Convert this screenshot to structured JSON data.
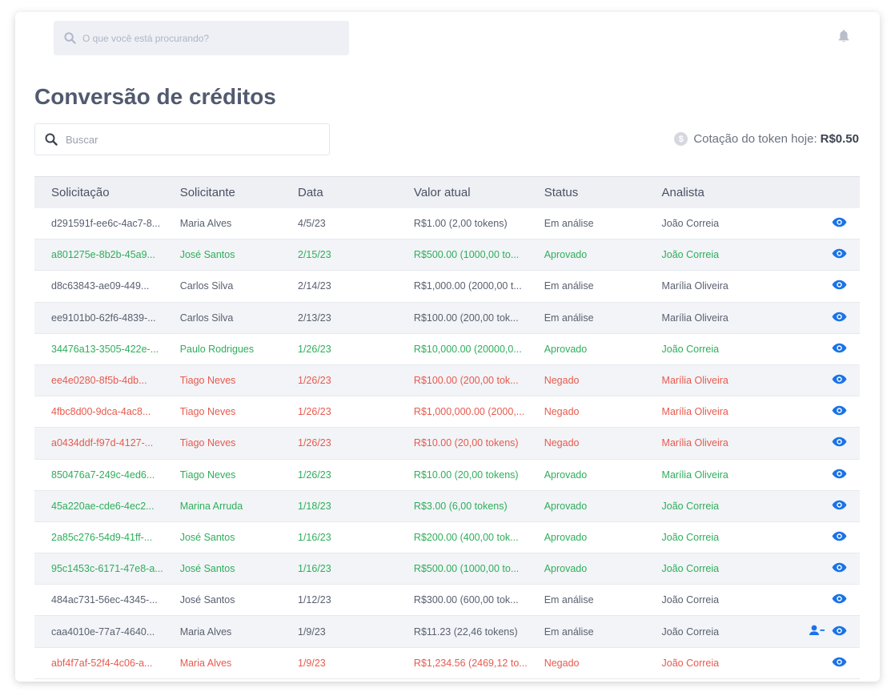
{
  "topbar": {
    "search_placeholder": "O que você está procurando?",
    "icons": {
      "search": "search-icon",
      "notifications": "bell-icon"
    }
  },
  "page": {
    "title": "Conversão de créditos",
    "search_placeholder": "Buscar",
    "quote_label": "Cotação do token hoje:",
    "quote_value": "R$0.50",
    "coin_glyph": "$"
  },
  "colors": {
    "approved": "#2fae5b",
    "denied": "#e75a4e",
    "neutral": "#5a6070",
    "action": "#1a73e8"
  },
  "table": {
    "headers": [
      "Solicitação",
      "Solicitante",
      "Data",
      "Valor atual",
      "Status",
      "Analista"
    ],
    "rows": [
      {
        "id": "d291591f-ee6c-4ac7-8...",
        "requester": "Maria Alves",
        "date": "4/5/23",
        "value": "R$1.00 (2,00 tokens)",
        "status": "Em análise",
        "analyst": "João Correia",
        "tone": "neutral",
        "assign": false
      },
      {
        "id": "a801275e-8b2b-45a9...",
        "requester": "José Santos",
        "date": "2/15/23",
        "value": "R$500.00 (1000,00 to...",
        "status": "Aprovado",
        "analyst": "João Correia",
        "tone": "ok",
        "assign": false
      },
      {
        "id": "d8c63843-ae09-449...",
        "requester": "Carlos Silva",
        "date": "2/14/23",
        "value": "R$1,000.00 (2000,00 t...",
        "status": "Em análise",
        "analyst": "Marília Oliveira",
        "tone": "neutral",
        "assign": false
      },
      {
        "id": "ee9101b0-62f6-4839-...",
        "requester": "Carlos Silva",
        "date": "2/13/23",
        "value": "R$100.00 (200,00 tok...",
        "status": "Em análise",
        "analyst": "Marília Oliveira",
        "tone": "neutral",
        "assign": false
      },
      {
        "id": "34476a13-3505-422e-...",
        "requester": "Paulo Rodrigues",
        "date": "1/26/23",
        "value": "R$10,000.00 (20000,0...",
        "status": "Aprovado",
        "analyst": "João Correia",
        "tone": "ok",
        "assign": false
      },
      {
        "id": "ee4e0280-8f5b-4db...",
        "requester": "Tiago Neves",
        "date": "1/26/23",
        "value": "R$100.00 (200,00 tok...",
        "status": "Negado",
        "analyst": "Marília Oliveira",
        "tone": "bad",
        "assign": false
      },
      {
        "id": "4fbc8d00-9dca-4ac8...",
        "requester": "Tiago Neves",
        "date": "1/26/23",
        "value": "R$1,000,000.00 (2000,...",
        "status": "Negado",
        "analyst": "Marília Oliveira",
        "tone": "bad",
        "assign": false
      },
      {
        "id": "a0434ddf-f97d-4127-...",
        "requester": "Tiago Neves",
        "date": "1/26/23",
        "value": "R$10.00 (20,00 tokens)",
        "status": "Negado",
        "analyst": "Marília Oliveira",
        "tone": "bad",
        "assign": false
      },
      {
        "id": "850476a7-249c-4ed6...",
        "requester": "Tiago Neves",
        "date": "1/26/23",
        "value": "R$10.00 (20,00 tokens)",
        "status": "Aprovado",
        "analyst": "Marília Oliveira",
        "tone": "ok",
        "assign": false
      },
      {
        "id": "45a220ae-cde6-4ec2...",
        "requester": "Marina Arruda",
        "date": "1/18/23",
        "value": "R$3.00 (6,00 tokens)",
        "status": "Aprovado",
        "analyst": "João Correia",
        "tone": "ok",
        "assign": false
      },
      {
        "id": "2a85c276-54d9-41ff-...",
        "requester": "José Santos",
        "date": "1/16/23",
        "value": "R$200.00 (400,00 tok...",
        "status": "Aprovado",
        "analyst": "João Correia",
        "tone": "ok",
        "assign": false
      },
      {
        "id": "95c1453c-6171-47e8-a...",
        "requester": "José Santos",
        "date": "1/16/23",
        "value": "R$500.00 (1000,00 to...",
        "status": "Aprovado",
        "analyst": "João Correia",
        "tone": "ok",
        "assign": false
      },
      {
        "id": "484ac731-56ec-4345-...",
        "requester": "José Santos",
        "date": "1/12/23",
        "value": "R$300.00 (600,00 tok...",
        "status": "Em análise",
        "analyst": "João Correia",
        "tone": "neutral",
        "assign": false
      },
      {
        "id": "caa4010e-77a7-4640...",
        "requester": "Maria Alves",
        "date": "1/9/23",
        "value": "R$11.23 (22,46 tokens)",
        "status": "Em análise",
        "analyst": "João Correia",
        "tone": "neutral",
        "assign": true
      },
      {
        "id": "abf4f7af-52f4-4c06-a...",
        "requester": "Maria Alves",
        "date": "1/9/23",
        "value": "R$1,234.56 (2469,12 to...",
        "status": "Negado",
        "analyst": "João Correia",
        "tone": "bad",
        "assign": false
      }
    ],
    "row_icons": {
      "view": "eye-icon",
      "assign": "assign-user-icon"
    }
  }
}
